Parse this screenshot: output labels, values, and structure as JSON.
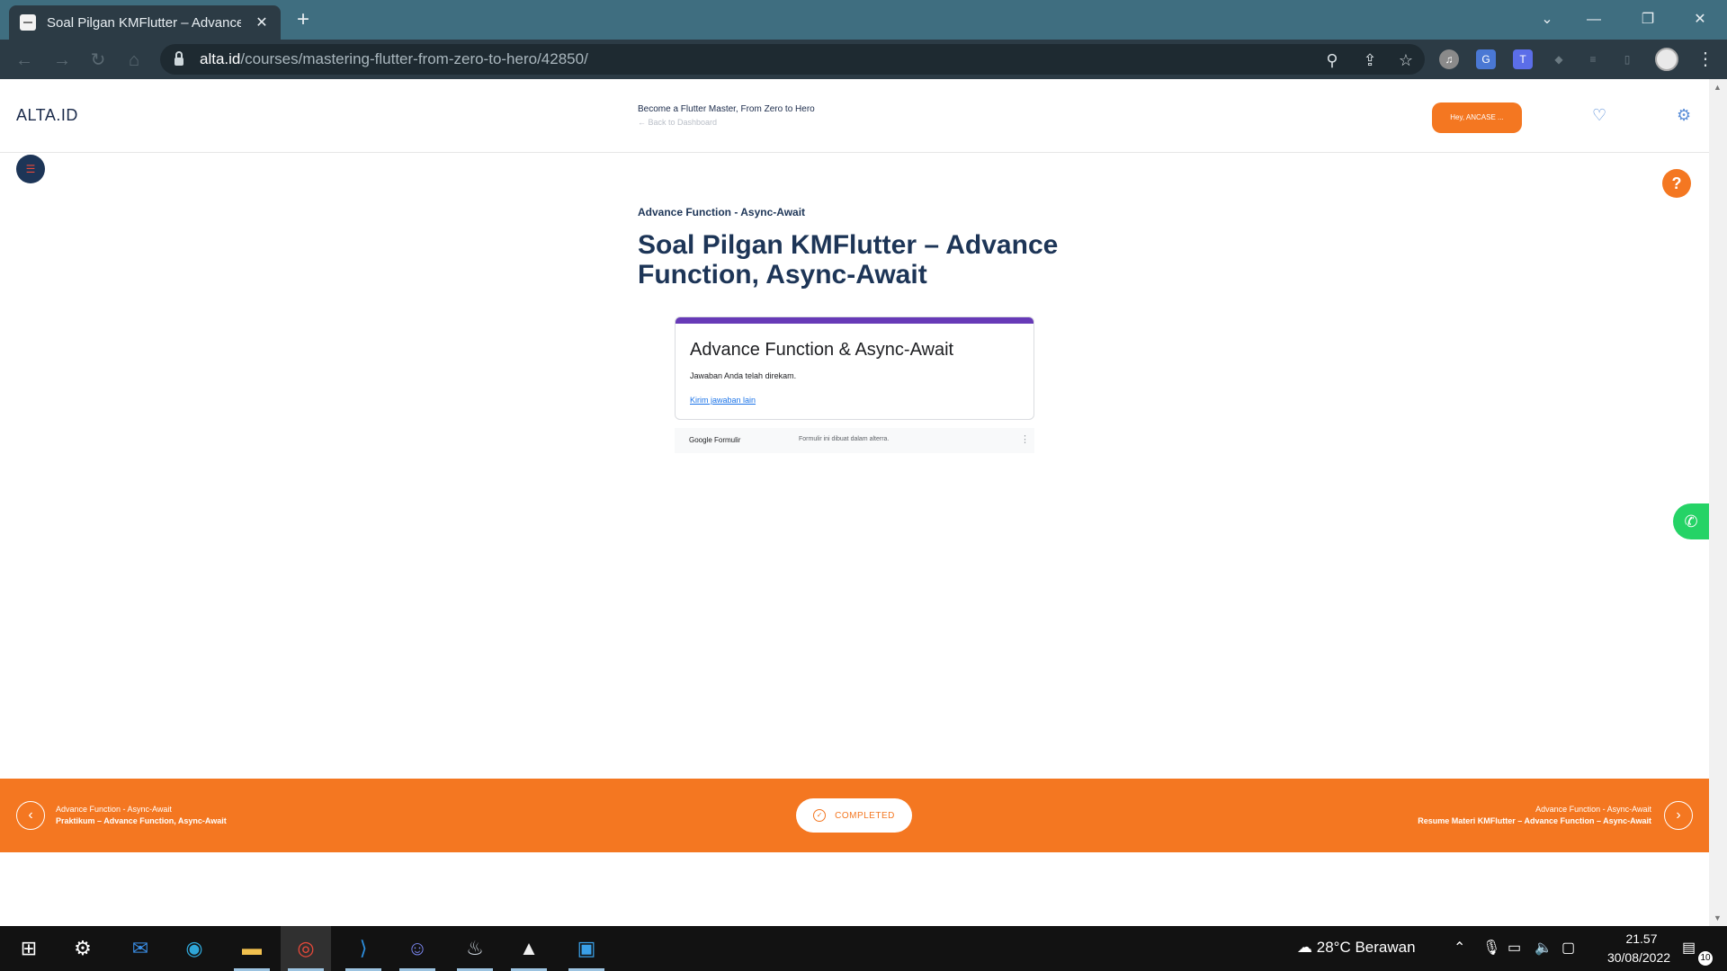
{
  "browser": {
    "tab_title": "Soal Pilgan KMFlutter – Advance",
    "tab_close": "✕",
    "new_tab": "+",
    "url_host": "alta.id",
    "url_path": "/courses/mastering-flutter-from-zero-to-hero/42850/"
  },
  "header": {
    "logo": "ALTA.ID",
    "course_title": "Become a Flutter Master, From Zero to Hero",
    "back_link": "Back to Dashboard",
    "user_label": "Hey, ANCASE ..."
  },
  "content": {
    "breadcrumb": "Advance Function - Async-Await",
    "title": "Soal Pilgan KMFlutter – Advance Function, Async-Await"
  },
  "form": {
    "title": "Advance Function & Async-Await",
    "message": "Jawaban Anda telah direkam.",
    "link": "Kirim jawaban lain",
    "brand": "Google Formulir",
    "note": "Formulir ini dibuat dalam alterra."
  },
  "footer_nav": {
    "prev_section": "Advance Function - Async-Await",
    "prev_title": "Praktikum – Advance Function, Async-Await",
    "completed": "COMPLETED",
    "next_section": "Advance Function - Async-Await",
    "next_title": "Resume Materi KMFlutter – Advance Function – Async-Await"
  },
  "taskbar": {
    "weather": "28°C  Berawan",
    "time": "21.57",
    "date": "30/08/2022",
    "notifications": "10"
  },
  "colors": {
    "brand_orange": "#f47721",
    "navy": "#1d3557",
    "form_accent": "#673ab7",
    "whatsapp": "#25d366"
  }
}
